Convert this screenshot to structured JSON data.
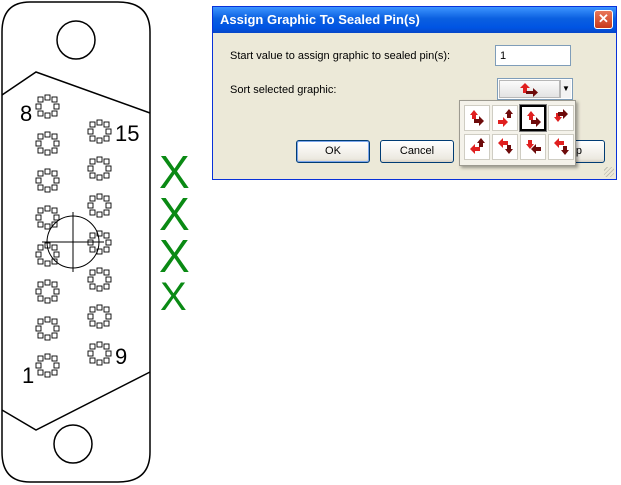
{
  "connector": {
    "pin_labels": [
      "8",
      "15",
      "1",
      "9"
    ]
  },
  "check_marks": [
    "X",
    "X",
    "X",
    "X"
  ],
  "dialog": {
    "title": "Assign Graphic To Sealed Pin(s)",
    "close_glyph": "✕",
    "start_label": "Start value to assign graphic to sealed pin(s):",
    "start_value": "1",
    "sort_label": "Sort selected graphic:",
    "selected_graphic": "arrows-up-then-right",
    "dropdown_glyph": "▼",
    "ok_label": "OK",
    "cancel_label": "Cancel",
    "help_label_visible": "p"
  },
  "graphic_options": [
    {
      "icon": "arrows-up-right-icon",
      "selected": false
    },
    {
      "icon": "arrows-right-up-icon",
      "selected": false
    },
    {
      "icon": "arrows-up-right-alt-icon",
      "selected": true
    },
    {
      "icon": "arrows-down-right-icon",
      "selected": false
    },
    {
      "icon": "arrows-left-up-icon",
      "selected": false
    },
    {
      "icon": "arrows-left-down-icon",
      "selected": false
    },
    {
      "icon": "arrows-down-left-icon",
      "selected": false
    },
    {
      "icon": "arrows-left-down-alt-icon",
      "selected": false
    }
  ],
  "colors": {
    "arrow_bright": "#e02020",
    "arrow_dark": "#6e0b0b",
    "x_mark": "#0a8a14",
    "title_bar": "#0054e3"
  }
}
